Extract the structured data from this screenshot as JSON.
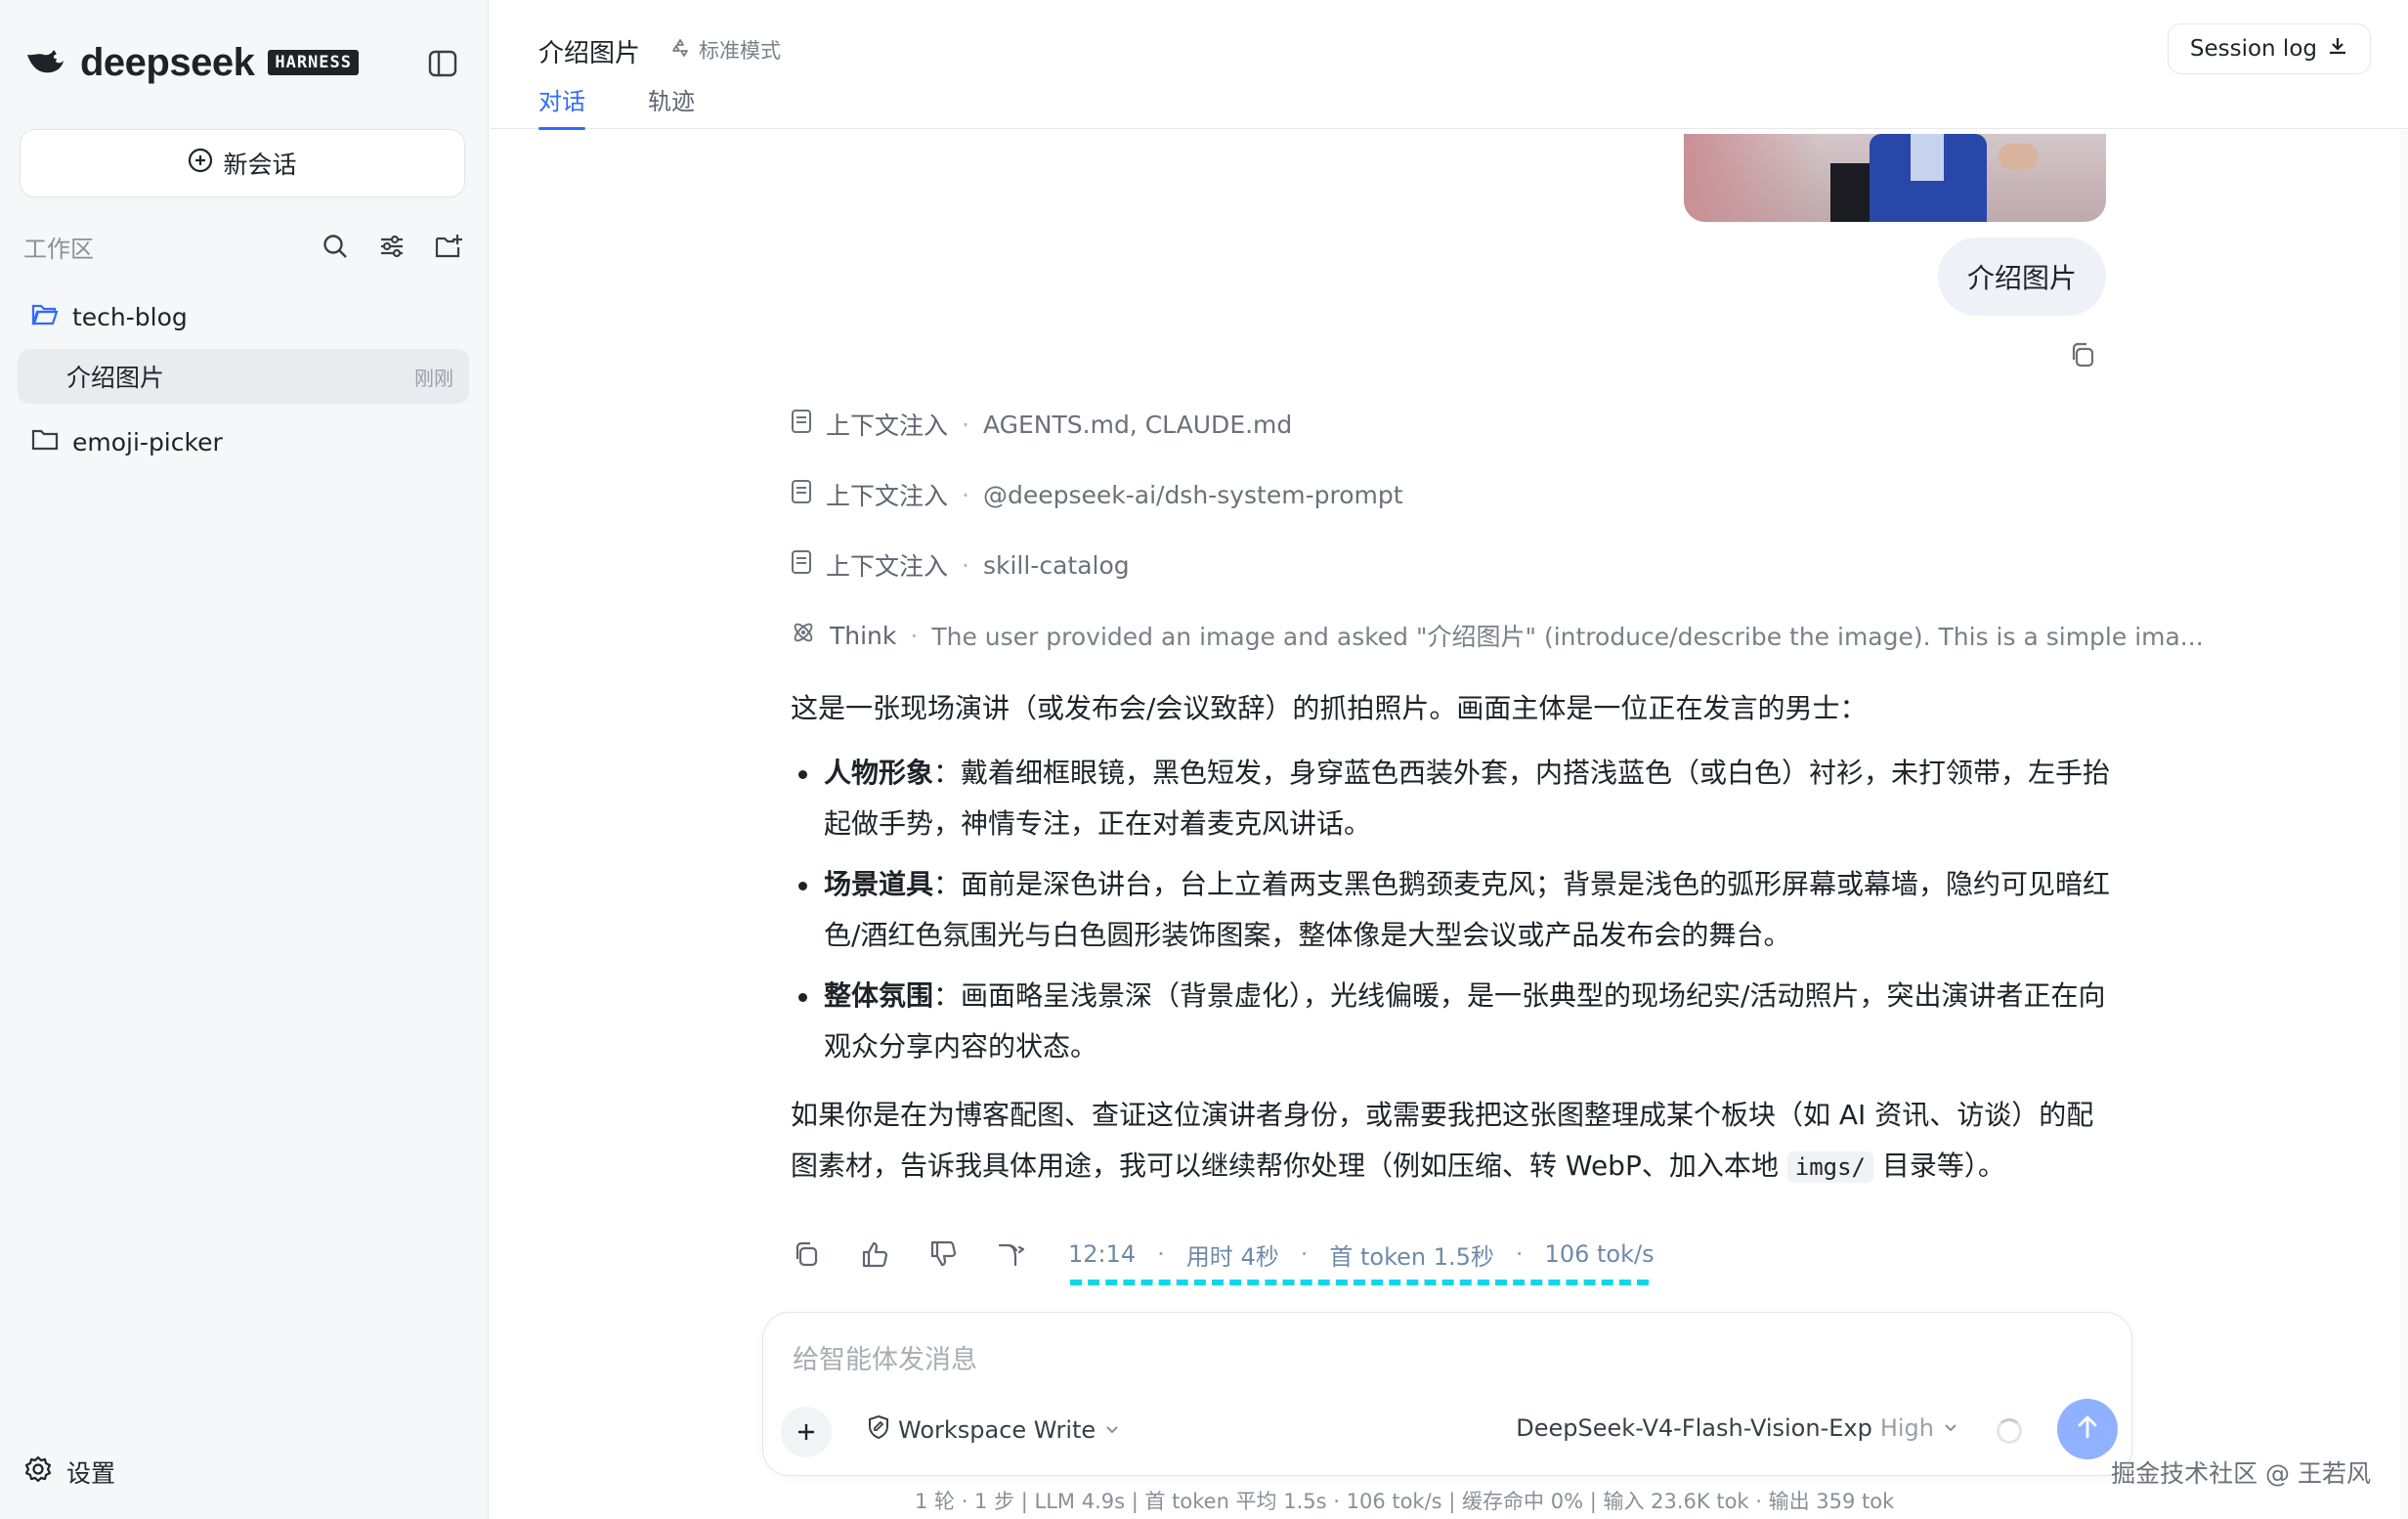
{
  "sidebar": {
    "brand": "deepseek",
    "badge": "HARNESS",
    "new_chat": "新会话",
    "workspace_label": "工作区",
    "tree": [
      {
        "label": "tech-blog"
      },
      {
        "label": "介绍图片",
        "time": "刚刚"
      },
      {
        "label": "emoji-picker"
      }
    ],
    "settings": "设置"
  },
  "header": {
    "title": "介绍图片",
    "mode": "标准模式",
    "tabs": [
      "对话",
      "轨迹"
    ],
    "session_log": "Session log"
  },
  "chat": {
    "user_message": "介绍图片",
    "context": [
      {
        "label": "上下文注入",
        "value": "AGENTS.md, CLAUDE.md"
      },
      {
        "label": "上下文注入",
        "value": "@deepseek-ai/dsh-system-prompt"
      },
      {
        "label": "上下文注入",
        "value": "skill-catalog"
      }
    ],
    "think": {
      "label": "Think",
      "value": "The user provided an image and asked \"介绍图片\" (introduce/describe the image). This is a simple ima..."
    },
    "answer": {
      "intro": "这是一张现场演讲（或发布会/会议致辞）的抓拍照片。画面主体是一位正在发言的男士：",
      "bullets": [
        {
          "title": "人物形象",
          "text": "：戴着细框眼镜，黑色短发，身穿蓝色西装外套，内搭浅蓝色（或白色）衬衫，未打领带，左手抬起做手势，神情专注，正在对着麦克风讲话。"
        },
        {
          "title": "场景道具",
          "text": "：面前是深色讲台，台上立着两支黑色鹅颈麦克风；背景是浅色的弧形屏幕或幕墙，隐约可见暗红色/酒红色氛围光与白色圆形装饰图案，整体像是大型会议或产品发布会的舞台。"
        },
        {
          "title": "整体氛围",
          "text": "：画面略呈浅景深（背景虚化），光线偏暖，是一张典型的现场纪实/活动照片，突出演讲者正在向观众分享内容的状态。"
        }
      ],
      "outro_1": "如果你是在为博客配图、查证这位演讲者身份，或需要我把这张图整理成某个板块（如 AI 资讯、访谈）的配图素材，告诉我具体用途，我可以继续帮你处理（例如压缩、转 WebP、加入本地 ",
      "code": "imgs/",
      "outro_2": " 目录等）。"
    },
    "meta": {
      "time": "12:14",
      "duration": "用时 4秒",
      "first_token": "首 token 1.5秒",
      "speed": "106 tok/s"
    }
  },
  "composer": {
    "placeholder": "给智能体发消息",
    "workspace_mode": "Workspace Write",
    "model": "DeepSeek-V4-Flash-Vision-Exp",
    "level": "High"
  },
  "footer": {
    "stats": "1 轮 · 1 步   |   LLM 4.9s   |   首 token 平均 1.5s · 106 tok/s   |   缓存命中 0%   |   输入 23.6K tok · 输出 359 tok",
    "watermark": "掘金技术社区 @ 王若风"
  },
  "colors": {
    "accent": "#2f6bff",
    "send": "#8fb1ff",
    "meta_underline": "#12d6e8"
  }
}
